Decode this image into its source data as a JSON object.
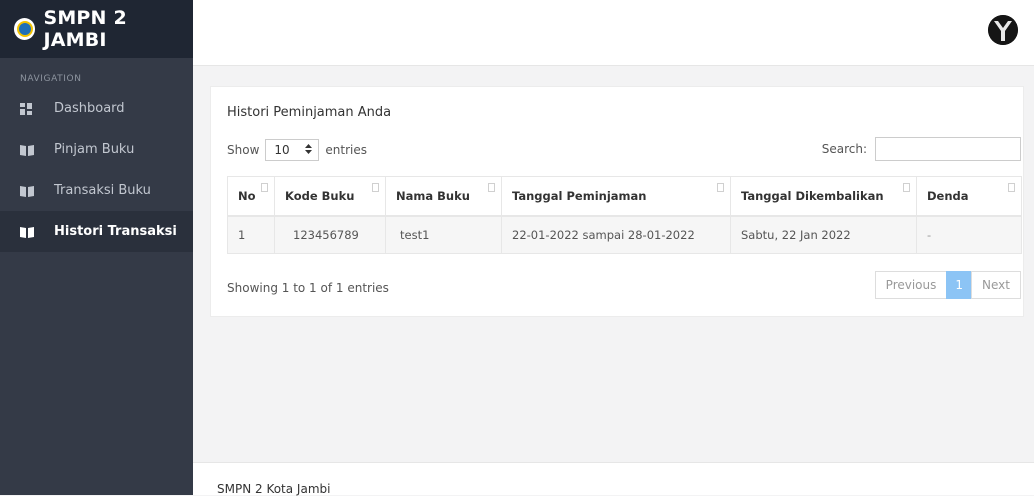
{
  "brand": {
    "title": "SMPN 2 JAMBI"
  },
  "sidebar": {
    "header": "NAVIGATION",
    "items": [
      {
        "label": "Dashboard",
        "icon": "dashboard-icon"
      },
      {
        "label": "Pinjam Buku",
        "icon": "book-open-icon"
      },
      {
        "label": "Transaksi Buku",
        "icon": "book-open-icon"
      },
      {
        "label": "Histori Transaksi",
        "icon": "book-open-icon",
        "active": true
      }
    ]
  },
  "card": {
    "title": "Histori Peminjaman Anda",
    "show_label": "Show",
    "entries_value": "10",
    "entries_label": "entries",
    "search_label": "Search:",
    "search_value": ""
  },
  "table": {
    "columns": [
      "No",
      "Kode Buku",
      "Nama Buku",
      "Tanggal Peminjaman",
      "Tanggal Dikembalikan",
      "Denda"
    ],
    "rows": [
      [
        "1",
        "123456789",
        "test1",
        "22-01-2022 sampai 28-01-2022",
        "Sabtu, 22 Jan 2022",
        "-"
      ]
    ]
  },
  "info": "Showing 1 to 1 of 1 entries",
  "pagination": {
    "previous": "Previous",
    "current": "1",
    "next": "Next"
  },
  "footer": {
    "text": "SMPN 2 Kota Jambi"
  },
  "colors": {
    "sidebar": "#343a47",
    "brand_bar": "#1f2633",
    "page_active": "#8cc4f5"
  }
}
